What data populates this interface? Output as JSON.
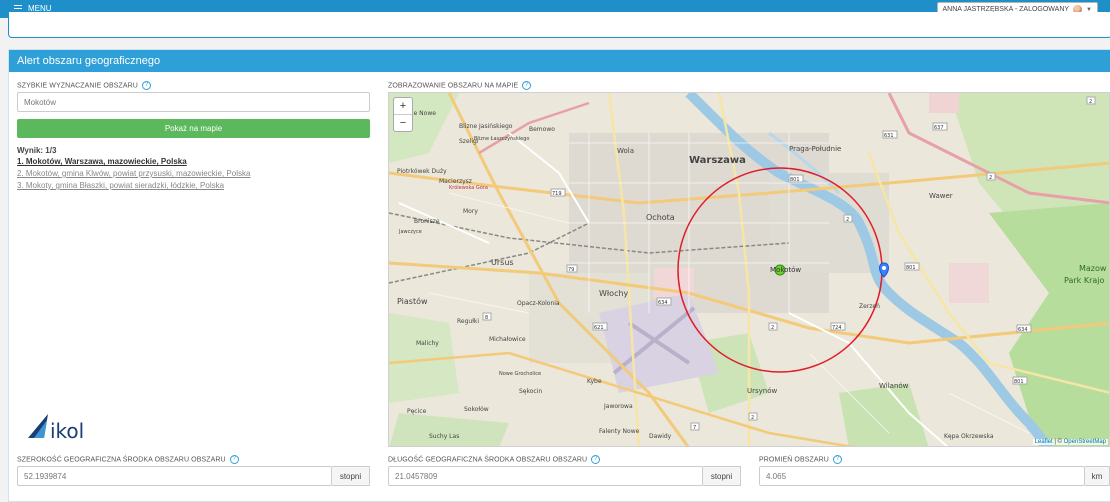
{
  "topbar": {
    "menu_label": "MENU",
    "user_label": "ANNA JASTRZĘBSKA - ZALOGOWANY"
  },
  "panel": {
    "title": "Alert obszaru geograficznego"
  },
  "quick": {
    "label": "SZYBKIE WYZNACZANIE OBSZARU",
    "placeholder": "Mokotów",
    "button": "Pokaż na mapie",
    "results_title": "Wynik: 1/3",
    "results": [
      "1. Mokotów, Warszawa, mazowieckie, Polska",
      "2. Mokotów, gmina Klwów, powiat przysuski, mazowieckie, Polska",
      "3. Mokoty, gmina Błaszki, powiat sieradzki, łódzkie, Polska"
    ]
  },
  "map": {
    "label": "ZOBRAZOWANIE OBSZARU NA MAPIE",
    "zoom_in": "+",
    "zoom_out": "−",
    "attribution_leaflet": "Leaflet",
    "attribution_sep": " | © ",
    "attribution_osm": "OpenStreetMap",
    "places": {
      "warszawa": "Warszawa",
      "praga": "Praga-Południe",
      "wola": "Wola",
      "ochota": "Ochota",
      "wlochy": "Włochy",
      "ursus": "Ursus",
      "piastow": "Piastów",
      "mokotow": "Mokotów",
      "wawer": "Wawer",
      "wilanow": "Wilanów",
      "ursynow": "Ursynów",
      "bemowo": "Bemowo",
      "mory": "Mory",
      "bronisze": "Bronisze",
      "regulki": "Regułki",
      "malichy": "Malichy",
      "opacz": "Opacz-Kolonia",
      "michalowice": "Michałowice",
      "piecice": "Pęcice",
      "sokolow": "Sokołów",
      "jaworowa": "Jaworowa",
      "dawidy": "Dawidy",
      "kepa": "Kępa Okrzewska",
      "mazow": "Mazow",
      "park": "Park Krajo",
      "babice": "Babice Nowe",
      "macierzysz": "Macierzysz",
      "szeligi": "Szeligi",
      "falenty": "Falenty Nowe",
      "piotrkowek": "Piotrkówek Duży",
      "jelonki": "Blizne Jasińskiego",
      "laszczynskiego": "Blizne Łaszczyńskiego",
      "zerzen": "Zerzeń",
      "krolewska": "Królewska Góra",
      "jawczyce": "Jawczyce",
      "kybe": "Kybe",
      "sekocin": "Sękocin",
      "suchy": "Suchy Las",
      "nowe": "Nowe Grocholice"
    },
    "roads": {
      "r2a": "2",
      "r2b": "2",
      "r2c": "2",
      "r2d": "2",
      "r2e": "2",
      "r79": "79",
      "r719": "719",
      "r801a": "801",
      "r801b": "801",
      "r801c": "801",
      "r634a": "634",
      "r634b": "634",
      "r631": "631",
      "r637": "637",
      "r621": "621",
      "r724": "724",
      "r7": "7",
      "r8": "8"
    },
    "circle_color": "#e11d2a",
    "circle_marker_label": "Mokotów",
    "center_marker_color": "#3b82f6"
  },
  "latitude": {
    "label": "SZEROKOŚĆ GEOGRAFICZNA ŚRODKA OBSZARU OBSZARU",
    "value": "52.1939874",
    "unit": "stopni"
  },
  "longitude": {
    "label": "DŁUGOŚĆ GEOGRAFICZNA ŚRODKA OBSZARU OBSZARU",
    "value": "21.0457809",
    "unit": "stopni"
  },
  "radius": {
    "label": "PROMIEŃ OBSZARU",
    "value": "4.065",
    "unit": "km"
  },
  "logo": {
    "text": "ikol"
  }
}
